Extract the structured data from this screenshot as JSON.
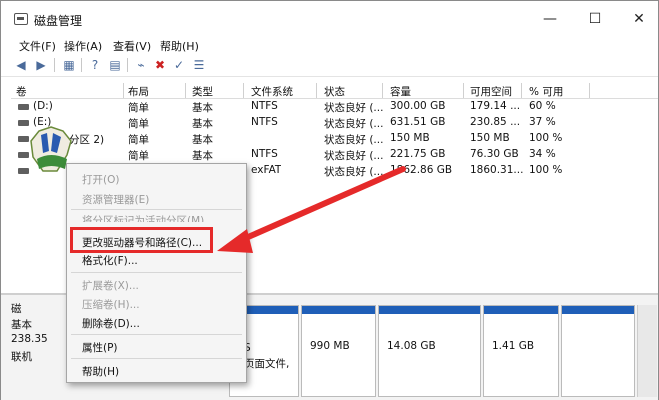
{
  "window": {
    "title": "磁盘管理",
    "minimize": "—",
    "maximize": "☐",
    "close": "✕"
  },
  "menubar": [
    "文件(F)",
    "操作(A)",
    "查看(V)",
    "帮助(H)"
  ],
  "table": {
    "columns": [
      "卷",
      "布局",
      "类型",
      "文件系统",
      "状态",
      "容量",
      "可用空间",
      "% 可用"
    ],
    "rows": [
      [
        "(D:)",
        "简单",
        "基本",
        "NTFS",
        "状态良好 (...",
        "300.00 GB",
        "179.14 ...",
        "60 %"
      ],
      [
        "(E:)",
        "简单",
        "基本",
        "NTFS",
        "状态良好 (...",
        "631.51 GB",
        "230.85 ...",
        "37 %"
      ],
      [
        "分区 2)",
        "简单",
        "基本",
        "",
        "状态良好 (...",
        "150 MB",
        "150 MB",
        "100 %"
      ],
      [
        "",
        "简单",
        "基本",
        "NTFS",
        "状态良好 (...",
        "221.75 GB",
        "76.30 GB",
        "34 %"
      ],
      [
        "",
        "简单",
        "",
        "exFAT",
        "状态良好 (...",
        "1862.86 GB",
        "1860.31...",
        "100 %"
      ]
    ]
  },
  "context_menu": {
    "items": [
      {
        "label": "打开(O)",
        "disabled": true
      },
      {
        "label": "资源管理器(E)",
        "disabled": true
      },
      {
        "label": "将分区标记为活动分区(M)",
        "disabled": true
      },
      {
        "label": "更改驱动器号和路径(C)...",
        "disabled": false,
        "highlighted": true
      },
      {
        "label": "格式化(F)...",
        "disabled": false
      },
      {
        "label": "扩展卷(X)...",
        "disabled": true
      },
      {
        "label": "压缩卷(H)...",
        "disabled": true
      },
      {
        "label": "删除卷(D)...",
        "disabled": false
      },
      {
        "label": "属性(P)",
        "disabled": false
      },
      {
        "label": "帮助(H)",
        "disabled": false
      }
    ]
  },
  "lower_pane": {
    "disk": {
      "name": "磁",
      "type": "基本",
      "size": "238.35",
      "status": "联机"
    },
    "partitions": [
      {
        "text": "S\n页面文件,"
      },
      {
        "text": "990 MB"
      },
      {
        "text": "14.08 GB"
      },
      {
        "text": "1.41 GB"
      }
    ]
  },
  "colors": {
    "highlight": "#e52a2a",
    "partition_bar": "#1f5fb8",
    "arrow": "#e52a2a"
  }
}
